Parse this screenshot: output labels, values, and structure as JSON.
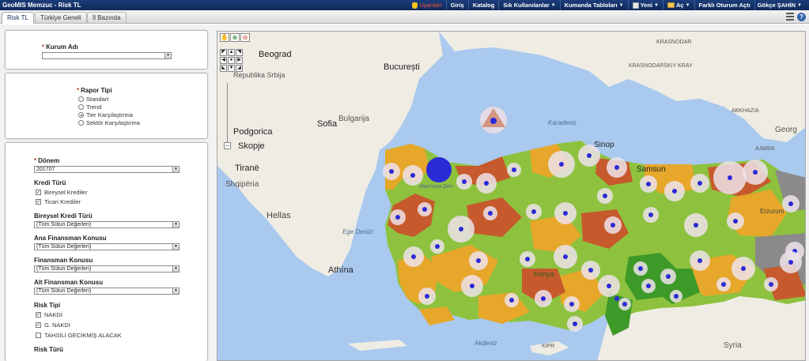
{
  "app": {
    "title": "GeoMIS Memzuc - Risk TL"
  },
  "topmenu": {
    "alerts": "Uyarılar!",
    "login": "Giriş",
    "catalog": "Katalog",
    "favorites": "Sık Kullanılanlar",
    "dashboards": "Kumanda Tabloları",
    "new": "Yeni",
    "open": "Aç",
    "signin_as": "Farklı Oturum Açtı",
    "user": "Gökçe ŞAHİN"
  },
  "tabs": [
    "Risk TL",
    "Türkiye Geneli",
    "İl Bazında"
  ],
  "left": {
    "kurum": {
      "label": "Kurum Adı",
      "value": ""
    },
    "rapor": {
      "label": "Rapor Tipi",
      "options": [
        "Standart",
        "Trend",
        "Tier Karşılaştırma",
        "Sektör Karşılaştırma"
      ],
      "selected_index": 2
    },
    "donem": {
      "label": "Dönem",
      "value": "201707"
    },
    "kredi_turu": {
      "label": "Kredi Türü",
      "items": [
        {
          "label": "Bireysel Krediler",
          "checked": true
        },
        {
          "label": "Ticari Krediler",
          "checked": true
        }
      ]
    },
    "bireysel_kredi_turu": {
      "label": "Bireysel Kredi Türü",
      "value": "(Tüm Sütun Değerleri)"
    },
    "ana_finansman": {
      "label": "Ana Finansman Konusu",
      "value": "(Tüm Sütun Değerleri)"
    },
    "finansman": {
      "label": "Finansman Konusu",
      "value": "(Tüm Sütun Değerleri)"
    },
    "alt_finansman": {
      "label": "Alt Finansman Konusu",
      "value": "(Tüm Sütun Değerleri)"
    },
    "risk_tipi": {
      "label": "Risk Tipi",
      "items": [
        {
          "label": "NAKDİ",
          "checked": true
        },
        {
          "label": "G. NAKDİ",
          "checked": true
        },
        {
          "label": "TAHSİLİ GECİKMİŞ ALACAK",
          "checked": false
        }
      ]
    },
    "risk_turu": {
      "label": "Risk Türü"
    }
  },
  "map": {
    "labels": {
      "beograd": "Beograd",
      "srbija": "Republika Srbija",
      "bucuresti": "București",
      "krasnodar": "KRASNODAR",
      "krasnodarskiy": "KRASNODARSKIY KRAY",
      "sofia": "Sofia",
      "bulgaria": "Bulgarija",
      "podgorica": "Podgorica",
      "skopje": "Skopje",
      "tirane": "Tiranë",
      "shqiperia": "Shqipëria",
      "karadeniz": "Karadeniz",
      "sinop": "Sinop",
      "samsun": "Samsun",
      "marmara": "Marmara Den",
      "hellas": "Hellas",
      "ege": "Ege Denizi",
      "athina": "Athína",
      "konya": "Konya",
      "akdeniz": "Akdeniz",
      "georgia": "Georg",
      "abkhazia": "ABKHAZIA",
      "ajaria": "AJARIA",
      "erzurum": "Erzurum",
      "syria": "Syria",
      "kipr": "KIPR"
    },
    "colors": {
      "sea": "#a9c9ee",
      "land": "#efece4",
      "green_light": "#8ec23e",
      "green_dark": "#3e9a28",
      "orange": "#e6a72a",
      "red": "#c65a2c",
      "gray": "#8a8a8a",
      "marker": "#2a2ad6"
    }
  }
}
